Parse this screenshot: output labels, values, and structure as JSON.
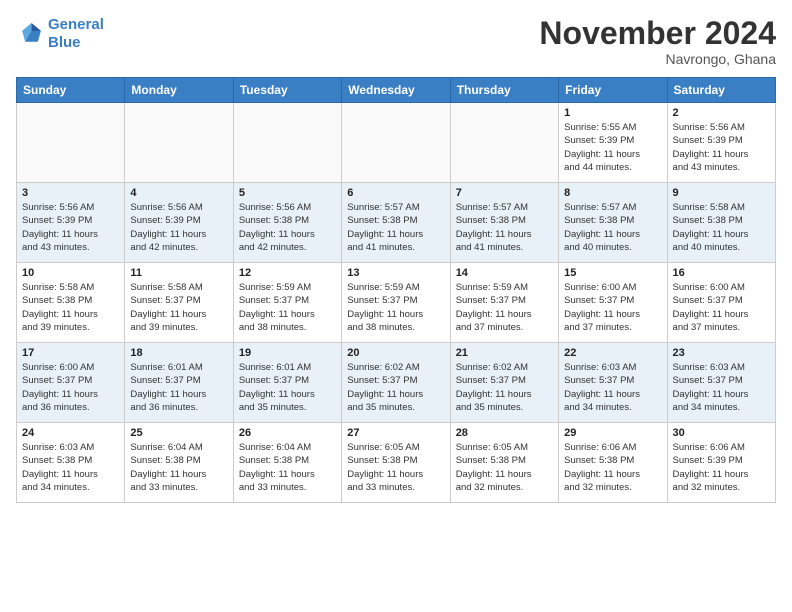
{
  "header": {
    "logo_line1": "General",
    "logo_line2": "Blue",
    "month": "November 2024",
    "location": "Navrongo, Ghana"
  },
  "weekdays": [
    "Sunday",
    "Monday",
    "Tuesday",
    "Wednesday",
    "Thursday",
    "Friday",
    "Saturday"
  ],
  "weeks": [
    [
      {
        "day": "",
        "info": ""
      },
      {
        "day": "",
        "info": ""
      },
      {
        "day": "",
        "info": ""
      },
      {
        "day": "",
        "info": ""
      },
      {
        "day": "",
        "info": ""
      },
      {
        "day": "1",
        "info": "Sunrise: 5:55 AM\nSunset: 5:39 PM\nDaylight: 11 hours\nand 44 minutes."
      },
      {
        "day": "2",
        "info": "Sunrise: 5:56 AM\nSunset: 5:39 PM\nDaylight: 11 hours\nand 43 minutes."
      }
    ],
    [
      {
        "day": "3",
        "info": "Sunrise: 5:56 AM\nSunset: 5:39 PM\nDaylight: 11 hours\nand 43 minutes."
      },
      {
        "day": "4",
        "info": "Sunrise: 5:56 AM\nSunset: 5:39 PM\nDaylight: 11 hours\nand 42 minutes."
      },
      {
        "day": "5",
        "info": "Sunrise: 5:56 AM\nSunset: 5:38 PM\nDaylight: 11 hours\nand 42 minutes."
      },
      {
        "day": "6",
        "info": "Sunrise: 5:57 AM\nSunset: 5:38 PM\nDaylight: 11 hours\nand 41 minutes."
      },
      {
        "day": "7",
        "info": "Sunrise: 5:57 AM\nSunset: 5:38 PM\nDaylight: 11 hours\nand 41 minutes."
      },
      {
        "day": "8",
        "info": "Sunrise: 5:57 AM\nSunset: 5:38 PM\nDaylight: 11 hours\nand 40 minutes."
      },
      {
        "day": "9",
        "info": "Sunrise: 5:58 AM\nSunset: 5:38 PM\nDaylight: 11 hours\nand 40 minutes."
      }
    ],
    [
      {
        "day": "10",
        "info": "Sunrise: 5:58 AM\nSunset: 5:38 PM\nDaylight: 11 hours\nand 39 minutes."
      },
      {
        "day": "11",
        "info": "Sunrise: 5:58 AM\nSunset: 5:37 PM\nDaylight: 11 hours\nand 39 minutes."
      },
      {
        "day": "12",
        "info": "Sunrise: 5:59 AM\nSunset: 5:37 PM\nDaylight: 11 hours\nand 38 minutes."
      },
      {
        "day": "13",
        "info": "Sunrise: 5:59 AM\nSunset: 5:37 PM\nDaylight: 11 hours\nand 38 minutes."
      },
      {
        "day": "14",
        "info": "Sunrise: 5:59 AM\nSunset: 5:37 PM\nDaylight: 11 hours\nand 37 minutes."
      },
      {
        "day": "15",
        "info": "Sunrise: 6:00 AM\nSunset: 5:37 PM\nDaylight: 11 hours\nand 37 minutes."
      },
      {
        "day": "16",
        "info": "Sunrise: 6:00 AM\nSunset: 5:37 PM\nDaylight: 11 hours\nand 37 minutes."
      }
    ],
    [
      {
        "day": "17",
        "info": "Sunrise: 6:00 AM\nSunset: 5:37 PM\nDaylight: 11 hours\nand 36 minutes."
      },
      {
        "day": "18",
        "info": "Sunrise: 6:01 AM\nSunset: 5:37 PM\nDaylight: 11 hours\nand 36 minutes."
      },
      {
        "day": "19",
        "info": "Sunrise: 6:01 AM\nSunset: 5:37 PM\nDaylight: 11 hours\nand 35 minutes."
      },
      {
        "day": "20",
        "info": "Sunrise: 6:02 AM\nSunset: 5:37 PM\nDaylight: 11 hours\nand 35 minutes."
      },
      {
        "day": "21",
        "info": "Sunrise: 6:02 AM\nSunset: 5:37 PM\nDaylight: 11 hours\nand 35 minutes."
      },
      {
        "day": "22",
        "info": "Sunrise: 6:03 AM\nSunset: 5:37 PM\nDaylight: 11 hours\nand 34 minutes."
      },
      {
        "day": "23",
        "info": "Sunrise: 6:03 AM\nSunset: 5:37 PM\nDaylight: 11 hours\nand 34 minutes."
      }
    ],
    [
      {
        "day": "24",
        "info": "Sunrise: 6:03 AM\nSunset: 5:38 PM\nDaylight: 11 hours\nand 34 minutes."
      },
      {
        "day": "25",
        "info": "Sunrise: 6:04 AM\nSunset: 5:38 PM\nDaylight: 11 hours\nand 33 minutes."
      },
      {
        "day": "26",
        "info": "Sunrise: 6:04 AM\nSunset: 5:38 PM\nDaylight: 11 hours\nand 33 minutes."
      },
      {
        "day": "27",
        "info": "Sunrise: 6:05 AM\nSunset: 5:38 PM\nDaylight: 11 hours\nand 33 minutes."
      },
      {
        "day": "28",
        "info": "Sunrise: 6:05 AM\nSunset: 5:38 PM\nDaylight: 11 hours\nand 32 minutes."
      },
      {
        "day": "29",
        "info": "Sunrise: 6:06 AM\nSunset: 5:38 PM\nDaylight: 11 hours\nand 32 minutes."
      },
      {
        "day": "30",
        "info": "Sunrise: 6:06 AM\nSunset: 5:39 PM\nDaylight: 11 hours\nand 32 minutes."
      }
    ]
  ]
}
